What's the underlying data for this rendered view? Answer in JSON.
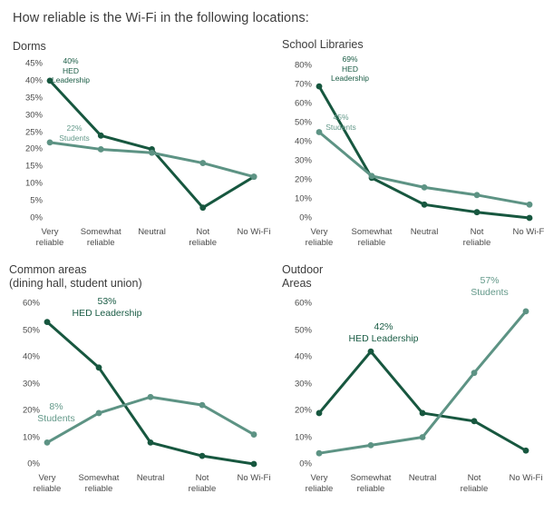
{
  "page": {
    "title": "How reliable is the Wi-Fi in the following locations:",
    "series_colors": {
      "hed_leadership": "#17573f",
      "students": "#5d9384"
    },
    "series_names": {
      "hed_leadership": "HED Leadership",
      "students": "Students"
    }
  },
  "charts": [
    {
      "id": "dorms",
      "title": "Dorms",
      "annotations": [
        {
          "text": "40%\nHED\nLeadership",
          "series": "hed_leadership",
          "size": "small"
        },
        {
          "text": "22%\nStudents",
          "series": "students",
          "size": "small"
        }
      ],
      "chart_data": {
        "type": "line",
        "title": "Dorms",
        "xlabel": "",
        "ylabel": "",
        "ylim": [
          0,
          45
        ],
        "ytick_step": 5,
        "ytick_labels": [
          "0%",
          "5%",
          "10%",
          "15%",
          "20%",
          "25%",
          "30%",
          "35%",
          "40%",
          "45%"
        ],
        "grid": false,
        "legend": "annotated-inline",
        "categories": [
          "Very reliable",
          "Somewhat reliable",
          "Neutral",
          "Not reliable",
          "No Wi-Fi"
        ],
        "series": [
          {
            "name": "HED Leadership",
            "values": [
              40,
              24,
              20,
              3,
              12
            ]
          },
          {
            "name": "Students",
            "values": [
              22,
              20,
              19,
              16,
              12
            ]
          }
        ]
      }
    },
    {
      "id": "school-libraries",
      "title": "School Libraries",
      "annotations": [
        {
          "text": "69%\nHED\nLeadership",
          "series": "hed_leadership",
          "size": "small"
        },
        {
          "text": "45%\nStudents",
          "series": "students",
          "size": "small"
        }
      ],
      "chart_data": {
        "type": "line",
        "title": "School Libraries",
        "xlabel": "",
        "ylabel": "",
        "ylim": [
          0,
          80
        ],
        "ytick_step": 10,
        "ytick_labels": [
          "0%",
          "10%",
          "20%",
          "30%",
          "40%",
          "50%",
          "60%",
          "70%",
          "80%"
        ],
        "grid": false,
        "legend": "annotated-inline",
        "categories": [
          "Very reliable",
          "Somewhat reliable",
          "Neutral",
          "Not reliable",
          "No Wi-Fi"
        ],
        "series": [
          {
            "name": "HED Leadership",
            "values": [
              69,
              21,
              7,
              3,
              0
            ]
          },
          {
            "name": "Students",
            "values": [
              45,
              22,
              16,
              12,
              7
            ]
          }
        ]
      }
    },
    {
      "id": "common-areas",
      "title": "Common areas\n(dining hall, student union)",
      "annotations": [
        {
          "text": "53%\nHED Leadership",
          "series": "hed_leadership",
          "size": "big"
        },
        {
          "text": "8%\nStudents",
          "series": "students",
          "size": "big"
        }
      ],
      "chart_data": {
        "type": "line",
        "title": "Common areas (dining hall, student union)",
        "xlabel": "",
        "ylabel": "",
        "ylim": [
          0,
          60
        ],
        "ytick_step": 10,
        "ytick_labels": [
          "0%",
          "10%",
          "20%",
          "30%",
          "40%",
          "50%",
          "60%"
        ],
        "grid": false,
        "legend": "annotated-inline",
        "categories": [
          "Very reliable",
          "Somewhat reliable",
          "Neutral",
          "Not reliable",
          "No Wi-Fi"
        ],
        "series": [
          {
            "name": "HED Leadership",
            "values": [
              53,
              36,
              8,
              3,
              0
            ]
          },
          {
            "name": "Students",
            "values": [
              8,
              19,
              25,
              22,
              11
            ]
          }
        ]
      }
    },
    {
      "id": "outdoor-areas",
      "title": "Outdoor\nAreas",
      "annotations": [
        {
          "text": "42%\nHED Leadership",
          "series": "hed_leadership",
          "size": "big"
        },
        {
          "text": "57%\nStudents",
          "series": "students",
          "size": "big"
        }
      ],
      "chart_data": {
        "type": "line",
        "title": "Outdoor Areas",
        "xlabel": "",
        "ylabel": "",
        "ylim": [
          0,
          60
        ],
        "ytick_step": 10,
        "ytick_labels": [
          "0%",
          "10%",
          "20%",
          "30%",
          "40%",
          "50%",
          "60%"
        ],
        "grid": false,
        "legend": "annotated-inline",
        "categories": [
          "Very reliable",
          "Somewhat reliable",
          "Neutral",
          "Not reliable",
          "No Wi-Fi"
        ],
        "series": [
          {
            "name": "HED Leadership",
            "values": [
              19,
              42,
              19,
              16,
              5
            ]
          },
          {
            "name": "Students",
            "values": [
              4,
              7,
              10,
              34,
              57
            ]
          }
        ]
      }
    }
  ]
}
